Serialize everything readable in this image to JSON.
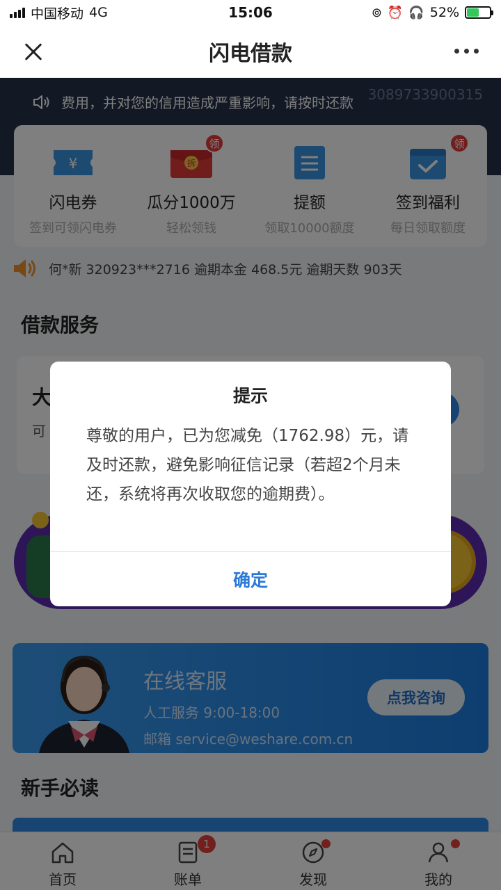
{
  "status_bar": {
    "carrier": "中国移动",
    "network": "4G",
    "time": "15:06",
    "battery": "52%"
  },
  "nav": {
    "title": "闪电借款"
  },
  "notice": {
    "text": "费用，并对您的信用造成严重影响，请按时还款",
    "account_number": "3089733900315"
  },
  "features": [
    {
      "icon": "coupon-icon",
      "title": "闪电券",
      "subtitle": "签到可领闪电券",
      "badge": ""
    },
    {
      "icon": "red-packet-icon",
      "title": "瓜分1000万",
      "subtitle": "轻松领钱",
      "badge": "领"
    },
    {
      "icon": "document-icon",
      "title": "提额",
      "subtitle": "领取10000额度",
      "badge": ""
    },
    {
      "icon": "calendar-check-icon",
      "title": "签到福利",
      "subtitle": "每日领取额度",
      "badge": "领"
    }
  ],
  "ticker": {
    "text": "何*新 320923***2716 逾期本金 468.5元 逾期天数 903天"
  },
  "loan_section": {
    "title": "借款服务",
    "card_title": "大",
    "card_sub": "可"
  },
  "service": {
    "title": "在线客服",
    "hours": "人工服务 9:00-18:00",
    "email": "邮箱 service@weshare.com.cn",
    "button": "点我咨询"
  },
  "newbie_section": {
    "title": "新手必读"
  },
  "tabs": [
    {
      "label": "首页",
      "icon": "home-icon",
      "badge": "",
      "dot": false
    },
    {
      "label": "账单",
      "icon": "bill-icon",
      "badge": "1",
      "dot": false
    },
    {
      "label": "发现",
      "icon": "compass-icon",
      "badge": "",
      "dot": true
    },
    {
      "label": "我的",
      "icon": "user-icon",
      "badge": "",
      "dot": true
    }
  ],
  "dialog": {
    "title": "提示",
    "message": "尊敬的用户，已为您减免（1762.98）元，请及时还款，避免影响征信记录（若超2个月未还，系统将再次收取您的逾期费）。",
    "confirm": "确定"
  },
  "colors": {
    "accent": "#2b7bd6",
    "banner_dark": "#27304a",
    "badge_red": "#e5403c"
  }
}
